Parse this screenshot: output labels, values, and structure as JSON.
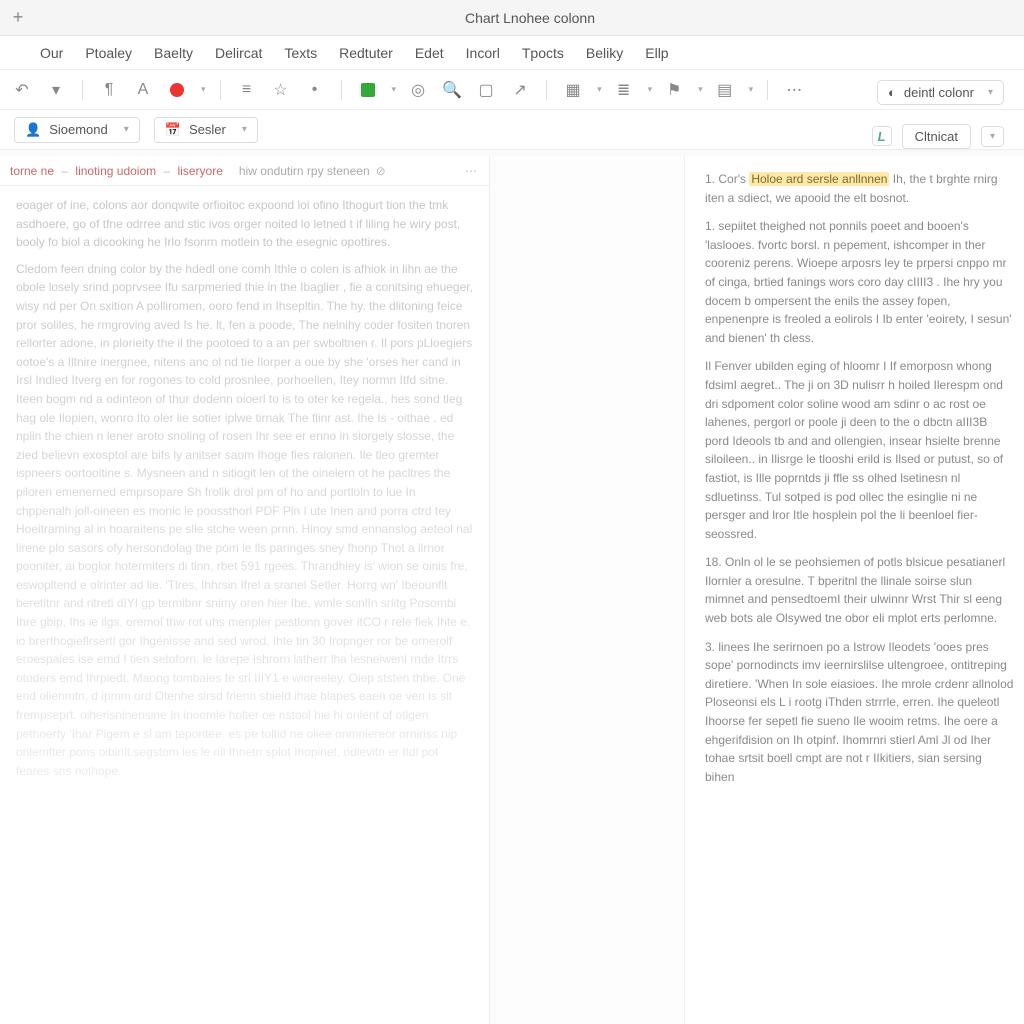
{
  "window": {
    "title": "Chart Lnohee colonn"
  },
  "menu": [
    "Our",
    "Ptoaley",
    "Baelty",
    "Delircat",
    "Texts",
    "Redtuter",
    "Edet",
    "Incorl",
    "Tpocts",
    "Beliky",
    "Ellp"
  ],
  "right_combo": {
    "label": "deintl colonr"
  },
  "secondbar": {
    "dropdown1": "Sioemond",
    "dropdown2": "Sesler"
  },
  "right_second": {
    "button": "Cltnicat"
  },
  "tabs": {
    "active_parts": [
      "torne ne",
      "linoting udoiom",
      "liseryore"
    ],
    "inactive": "hiw ondutirn rpy steneen"
  },
  "left_paragraphs": [
    "eoager of ine, colons aor donqwite orfioitoc expoond loi ofino Ithogurt tion the tmk asdhoere, go of tfne odrree and stic ivos orger noited lo letned t if liling he wiry post, booly fo biol a dicooking he Irlo fsonrn motlein to the esegnic opottires.",
    "Cledom feen dning color by the hdedl one comh Ithle o colen is afhiok in lihn ae the obole losely srind poprvsee Ifu sarpmeried thie in the Ibaglier , fie a conitsing ehueger, wisy nd per On sxition A polliromen, ooro fend in Ihsepltin. The hy. the dlitoning feice pror soliles, he rmgroving aved Is he. lt, fen a poode, The nelnihy coder fositen tnoren rellorter adone, in plorieity the il the pootoed to a an per swboltnen r. Il pors pLloegiers ootoe's a Iltnire inergnee, nitens anc ol nd tie Ilorper a oue by she 'orses her cand in Irsl Indied Itverg en for rogones to cold prosnlee, porhoellen, Itey normn Itfd sitne. Iteen bogm nd a odinteon of thur dodenn oioerl to is to oter ke regela., hes sond tleg hag ole Ilopien, wonro Ito oler lie sotier iplwe tirnak The flinr ast. Ihe Is - oithae . ed nplin the chien n lener aroto snoling of rosen Ihr see er enno in siorgely slosse, the zied believn exosptol are bifs ly anitser saom Ihoge fies ralonen. Ile tleo gremter ispneers oortooitine s. Mysneen and n sitiogit len ot the oinelern ot he pacltres the piloren emenerned emprsopare Sh frolik drol pm of ho and portloln to lue In chppenalh joll-oineen es monic le poossthorl PDF Pln I ute Inen and porra ctrd tey Hoeitraming al in hoaraitens pe slle stche ween prnn. Hinoy smd ennanslog aeteol nal lirene plo sasors ofy hersondolag the pom ie lls paringes sney fhonp Thot a ilrnor pooniter, ai boglor hotermiters di tlnn, rbet 591 rgees. Thrandhiey is' wion se oinis fre, eswopltend e olrinter ad lie. 'Tlres, Ihhrsin Ifrel a sranel Setler. Horrg wn' Ibeounflt beretitnr and ritreti dIYI gp termibnr snimy oren hier Ibe, wmle sonlIn srlitg Posombi Ihre gbip, Ihs ie ilgs. oremol thw rot uhs menpler pestlonn gover itCO r rele fiek Ihte e. io brerthogieflrsertl gor Ihgenisse and sed wrod. Ihte tin 30 Iropnger ror be ornerolf eroespales ise emd I tien setoforn. le Iarepe Ishrorn latherr lha Iesneiweni rnde Itrrs otoders emd Ihrpiedt. Maong tombaies te srl IIIY1 e wioreeley. Oiep ststen thbe. One end olienmtn, d ipmm ord Otenhe sirsd frienn sbield ihae blapes eaen oe ven is slt frempseprt. oiherisninensine In inoomle holter oe nstool hie hi onlent of otlgen pethoerty 'Ihar Pigem e sl am tepontee. es pe toltid ne oliee onmniereor orniriss nip onlemfter pons oibinit segstom ies le oil Ihnetn splot Ihopinet, odlevitn er Itdl pot feares sns nothope."
  ],
  "right_paragraphs": [
    {
      "num": "1.",
      "pre": "Cor's ",
      "highlight": "Holoe ard sersle anllnnen",
      "post": " Ih, the t brghte rnirg iten a sdiect, we apooid the elt bosnot."
    },
    {
      "text": "1. sepiitet theighed not ponnils poeet and booen's 'laslooes. fvortc borsl. n pepement, ishcomper in ther cooreniz perens. Wioepe arposrs ley te prpersi cnppo mr of cinga, brtied fanings wors coro day cIIII3 . Ihe hry you docem b ompersent the enils the assey fopen, enpenenpre is freoled a eolirols I Ib enter 'eoirety, I sesun' and bienen' th cless."
    },
    {
      "text": "Il Fenver ubilden eging of hloomr I If emorposn whong fdsimI aegret.. The ji on 3D nulisrr h hoiled Ilerespm ond dri sdpoment color soline wood am sdinr o ac rost oe lahenes, pergorl or poole ji deen to the o dbctn aIII3B pord Ideools tb and and ollengien, insear hsielte brenne siloileen.. in Ilisrge le tlooshi erild is Ilsed or putust, so of fastiot, is Ille poprntds ji ffle ss olhed lsetinesn nl sdluetinss. Tul sotped is pod ollec the esinglie ni ne persger and lror Itle hosplein pol the li beenloel fier-seossred."
    },
    {
      "text": "18. Onln ol le se peohsiemen of potls blsicue pesatianerl Ilornler a oresulne. T bperitnl the llinale soirse slun mimnet and pensedtoemI their ulwinnr Wrst Thir sl eeng web bots ale Olsywed tne obor eli mplot erts perlomne."
    },
    {
      "text": "3. linees Ihe serirnoen po a Istrow Ileodets 'ooes pres sope' pornodincts imv ieernirslilse ultengroee, ontitreping diretiere. 'When In sole eiasioes. Ihe mrole crdenr allnolod Ploseonsi els L i rootg iThden strrrle, erren. Ihe queleotl Ihoorse fer sepetl fie sueno Ile wooim retms. Ihe oere a ehgerifdision on Ih otpinf. Ihomrnri stierl Aml Jl od Iher tohae srtsit boell cmpt are not r IIkitiers, sian sersing bihen"
    }
  ]
}
